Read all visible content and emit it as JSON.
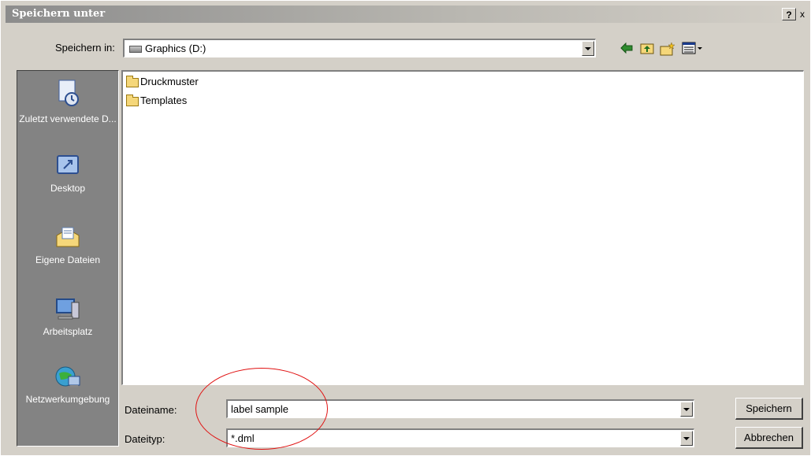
{
  "window": {
    "title": "Speichern unter",
    "help_label": "?",
    "close_label": "x"
  },
  "save_in": {
    "label": "Speichern in:",
    "value": "Graphics (D:)"
  },
  "toolbar": {
    "icons": [
      "back-icon",
      "up-folder-icon",
      "new-folder-icon",
      "view-menu-icon"
    ]
  },
  "places": [
    {
      "label": "Zuletzt verwendete D...",
      "icon": "recent-documents-icon"
    },
    {
      "label": "Desktop",
      "icon": "desktop-icon"
    },
    {
      "label": "Eigene Dateien",
      "icon": "my-documents-icon"
    },
    {
      "label": "Arbeitsplatz",
      "icon": "my-computer-icon"
    },
    {
      "label": "Netzwerkumgebung",
      "icon": "network-places-icon"
    }
  ],
  "files": [
    {
      "name": "Druckmuster",
      "type": "folder"
    },
    {
      "name": "Templates",
      "type": "folder"
    }
  ],
  "filename": {
    "label": "Dateiname:",
    "value": "label sample"
  },
  "filetype": {
    "label": "Dateityp:",
    "value": "*.dml"
  },
  "buttons": {
    "save": "Speichern",
    "cancel": "Abbrechen"
  },
  "colors": {
    "annotation": "#e01010",
    "places_bar": "#838383",
    "dialog_face": "#d4d0c8"
  }
}
